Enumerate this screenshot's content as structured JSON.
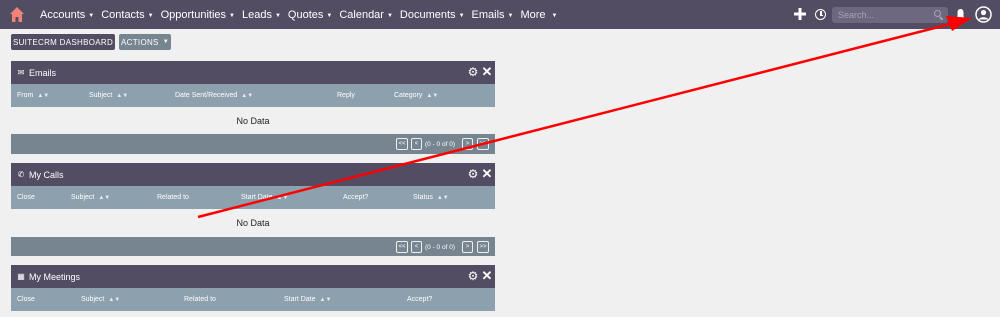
{
  "nav": {
    "items": [
      {
        "label": "Accounts"
      },
      {
        "label": "Contacts"
      },
      {
        "label": "Opportunities"
      },
      {
        "label": "Leads"
      },
      {
        "label": "Quotes"
      },
      {
        "label": "Calendar"
      },
      {
        "label": "Documents"
      },
      {
        "label": "Emails"
      },
      {
        "label": "More"
      }
    ],
    "search_placeholder": "Search..."
  },
  "actions": {
    "dashboard_label": "SUITECRM DASHBOARD",
    "actions_label": "ACTIONS"
  },
  "dashlets": [
    {
      "title": "Emails",
      "columns": [
        "From",
        "Subject",
        "Date Sent/Received",
        "Reply",
        "Category"
      ],
      "empty_text": "No Data",
      "pagination": {
        "first": "<<",
        "prev": "<",
        "range": "(0 - 0 of 0)",
        "next": ">",
        "last": ">>"
      }
    },
    {
      "title": "My Calls",
      "columns": [
        "Close",
        "Subject",
        "Related to",
        "Start Date",
        "Accept?",
        "Status"
      ],
      "empty_text": "No Data",
      "pagination": {
        "first": "<<",
        "prev": "<",
        "range": "(0 - 0 of 0)",
        "next": ">",
        "last": ">>"
      }
    },
    {
      "title": "My Meetings",
      "columns": [
        "Close",
        "Subject",
        "Related to",
        "Start Date",
        "Accept?"
      ]
    }
  ],
  "colors": {
    "nav_bg": "#534d64",
    "column_header_bg": "#8da0ad",
    "footer_bg": "#778591",
    "home_icon": "#f08377",
    "annotation_arrow": "#ff0000"
  },
  "icons": [
    "home-icon",
    "plus-icon",
    "history-icon",
    "search-icon",
    "bell-icon",
    "user-avatar-icon",
    "gear-icon",
    "close-icon",
    "email-icon",
    "phone-icon",
    "calendar-icon"
  ]
}
